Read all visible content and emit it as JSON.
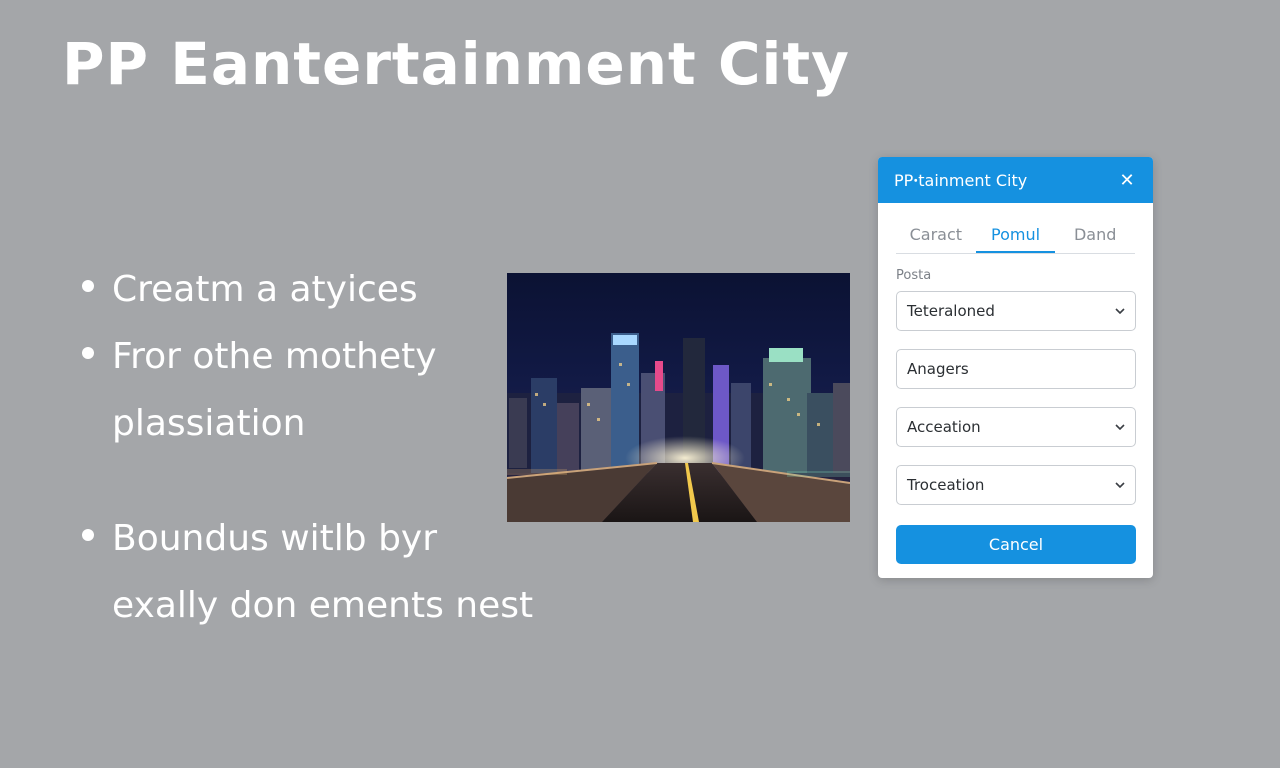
{
  "slide": {
    "title": "PP Eantertainment City",
    "bullets": [
      "Creatm a atyices",
      "Fror othe mothety plassiation",
      "Boundus witlb byr exally don ements nest"
    ]
  },
  "dialog": {
    "title": "PPꞏtainment City",
    "tabs": [
      {
        "label": "Caract",
        "active": false
      },
      {
        "label": "Pomul",
        "active": true
      },
      {
        "label": "Dand",
        "active": false
      }
    ],
    "field_label": "Posta",
    "fields": [
      {
        "value": "Teteraloned",
        "type": "select"
      },
      {
        "value": "Anagers",
        "type": "input"
      },
      {
        "value": "Acceation",
        "type": "select"
      },
      {
        "value": "Troceation",
        "type": "select"
      }
    ],
    "cancel_label": "Cancel"
  },
  "colors": {
    "accent": "#1591e0",
    "background": "#a4a6a9"
  },
  "icons": {
    "close": "close-icon",
    "dropdown": "chevron-down-icon"
  }
}
